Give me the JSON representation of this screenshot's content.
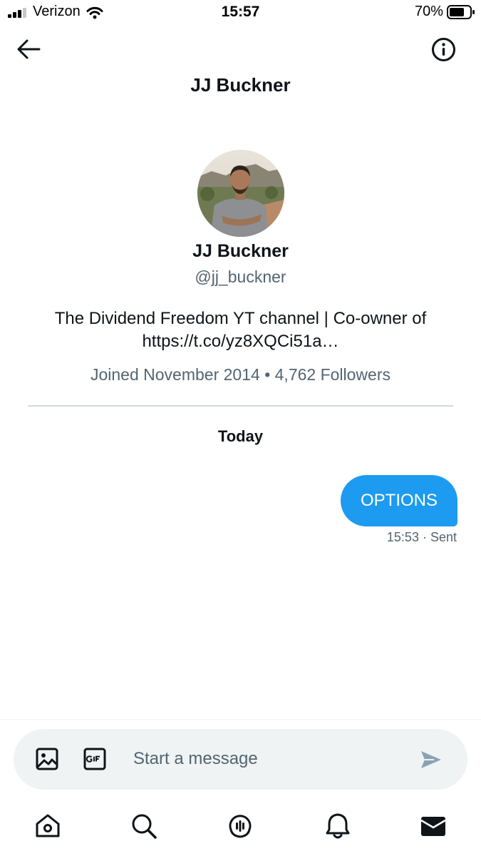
{
  "status_bar": {
    "carrier": "Verizon",
    "time": "15:57",
    "battery": "70%"
  },
  "header": {
    "title": "JJ Buckner"
  },
  "profile": {
    "name": "JJ Buckner",
    "handle": "@jj_buckner",
    "bio_line1": "The Dividend Freedom YT channel | Co-owner of",
    "bio_line2": "https://t.co/yz8XQCi51a…",
    "meta": "Joined November 2014 • 4,762 Followers"
  },
  "conversation": {
    "date_label": "Today",
    "messages": [
      {
        "text": "OPTIONS",
        "time": "15:53",
        "status": "· Sent"
      }
    ]
  },
  "composer": {
    "placeholder": "Start a message"
  },
  "colors": {
    "accent": "#1d9bf0",
    "secondary_text": "#536471",
    "composer_bg": "#eff3f4"
  },
  "icons": {
    "header": [
      "back-arrow-icon",
      "info-icon"
    ],
    "composer": [
      "image-icon",
      "gif-icon",
      "send-icon"
    ],
    "tabbar": [
      "home-icon",
      "search-icon",
      "spaces-icon",
      "notifications-icon",
      "messages-icon"
    ]
  }
}
